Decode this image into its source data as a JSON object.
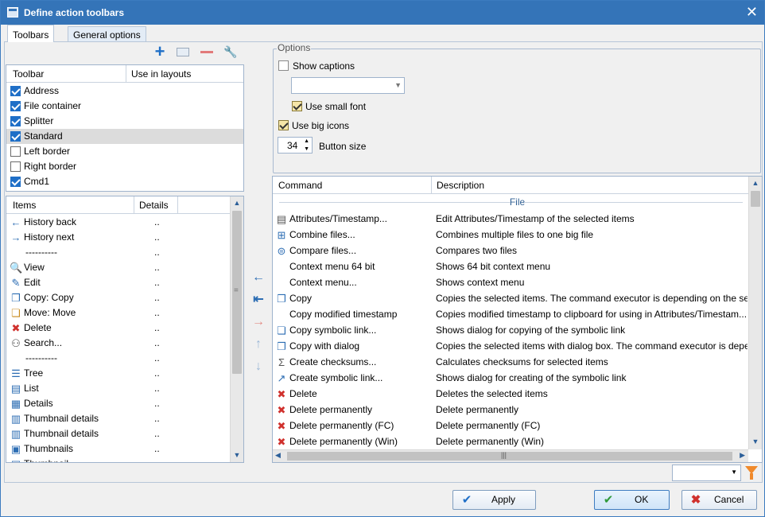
{
  "window": {
    "title": "Define action toolbars",
    "close": "✕"
  },
  "tabs": [
    {
      "label": "Toolbars"
    },
    {
      "label": "General options"
    }
  ],
  "toolbar_list": {
    "col_toolbar": "Toolbar",
    "col_layouts": "Use in layouts",
    "items": [
      {
        "label": "Address",
        "checked": true
      },
      {
        "label": "File container",
        "checked": true
      },
      {
        "label": "Splitter",
        "checked": true
      },
      {
        "label": "Standard",
        "checked": true
      },
      {
        "label": "Left border",
        "checked": false
      },
      {
        "label": "Right border",
        "checked": false
      },
      {
        "label": "Cmd1",
        "checked": true
      }
    ]
  },
  "items_list": {
    "col_items": "Items",
    "col_details": "Details",
    "items": [
      {
        "label": "History back",
        "details": "..",
        "icon": "arrow-left-icon"
      },
      {
        "label": "History next",
        "details": "..",
        "icon": "arrow-right-icon"
      },
      {
        "label": "----------",
        "details": "..",
        "icon": ""
      },
      {
        "label": "View",
        "details": "..",
        "icon": "magnifier-icon"
      },
      {
        "label": "Edit",
        "details": "..",
        "icon": "pencil-icon"
      },
      {
        "label": "Copy: Copy",
        "details": "..",
        "icon": "copy-icon"
      },
      {
        "label": "Move: Move",
        "details": "..",
        "icon": "move-icon"
      },
      {
        "label": "Delete",
        "details": "..",
        "icon": "delete-x-icon"
      },
      {
        "label": "Search...",
        "details": "..",
        "icon": "binoculars-icon"
      },
      {
        "label": "----------",
        "details": "..",
        "icon": ""
      },
      {
        "label": "Tree",
        "details": "..",
        "icon": "tree-icon"
      },
      {
        "label": "List",
        "details": "..",
        "icon": "list-icon"
      },
      {
        "label": "Details",
        "details": "..",
        "icon": "details-icon"
      },
      {
        "label": "Thumbnail details",
        "details": "..",
        "icon": "thumbnail-details-icon"
      },
      {
        "label": "Thumbnail details",
        "details": "..",
        "icon": "thumbnail-details-icon"
      },
      {
        "label": "Thumbnails",
        "details": "..",
        "icon": "thumbnails-icon"
      },
      {
        "label": "Thumbnail...",
        "details": "",
        "icon": "thumbnails-icon"
      }
    ]
  },
  "options": {
    "legend": "Options",
    "show_captions": "Show captions",
    "use_small_font": "Use small font",
    "use_big_icons": "Use big icons",
    "button_size_value": "34",
    "button_size_label": "Button size"
  },
  "commands": {
    "col_command": "Command",
    "col_description": "Description",
    "section": "File",
    "rows": [
      {
        "cmd": "Attributes/Timestamp...",
        "desc": "Edit Attributes/Timestamp of the selected items",
        "icon": "attributes-icon"
      },
      {
        "cmd": "Combine files...",
        "desc": "Combines multiple files to one big file",
        "icon": "combine-icon"
      },
      {
        "cmd": "Compare files...",
        "desc": "Compares two files",
        "icon": "compare-icon"
      },
      {
        "cmd": "Context menu 64 bit",
        "desc": "Shows 64 bit context menu",
        "icon": ""
      },
      {
        "cmd": "Context menu...",
        "desc": "Shows context menu",
        "icon": ""
      },
      {
        "cmd": "Copy",
        "desc": "Copies the selected items. The command executor is depending on the set...",
        "icon": "copy-icon"
      },
      {
        "cmd": "Copy modified timestamp",
        "desc": "Copies modified timestamp to clipboard for using in Attributes/Timestam...",
        "icon": ""
      },
      {
        "cmd": "Copy symbolic link...",
        "desc": "Shows dialog for copying of the symbolic link",
        "icon": "symlink-copy-icon"
      },
      {
        "cmd": "Copy with dialog",
        "desc": "Copies the selected items with dialog box. The command executor is depe...",
        "icon": "copy-icon"
      },
      {
        "cmd": "Create checksums...",
        "desc": "Calculates checksums for selected items",
        "icon": "checksum-icon"
      },
      {
        "cmd": "Create symbolic link...",
        "desc": "Shows dialog for creating of the symbolic link",
        "icon": "symlink-create-icon"
      },
      {
        "cmd": "Delete",
        "desc": "Deletes the selected items",
        "icon": "delete-x-icon"
      },
      {
        "cmd": "Delete permanently",
        "desc": "Delete permanently",
        "icon": "delete-x-icon"
      },
      {
        "cmd": "Delete permanently (FC)",
        "desc": "Delete permanently (FC)",
        "icon": "delete-x-icon"
      },
      {
        "cmd": "Delete permanently (Win)",
        "desc": "Delete permanently (Win)",
        "icon": "delete-x-icon"
      }
    ]
  },
  "hscroll_grip": "|||",
  "vscroll_grip": "=",
  "buttons": {
    "apply": "Apply",
    "ok": "OK",
    "cancel": "Cancel"
  },
  "colors": {
    "accent": "#3474b8",
    "check": "#1f6fc7",
    "delete": "#d0312d",
    "add": "#1f6fc7"
  }
}
